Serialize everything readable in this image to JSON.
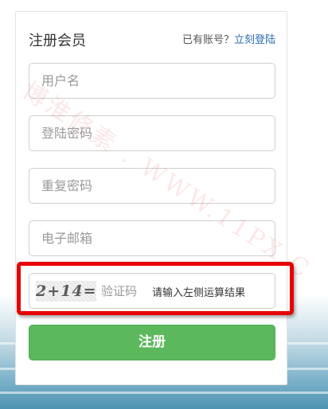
{
  "form": {
    "title": "注册会员",
    "login_prompt": "已有账号？",
    "login_link": "立刻登陆",
    "username_placeholder": "用户名",
    "password_placeholder": "登陆密码",
    "confirm_password_placeholder": "重复密码",
    "email_placeholder": "电子邮箱",
    "captcha_image_text": "2+14=",
    "captcha_placeholder": "验证码",
    "captcha_hint": "请输入左侧运算结果",
    "submit_label": "注册"
  },
  "watermark": {
    "text": "博淮修素 . WWW.11PX.C"
  },
  "colors": {
    "accent_green": "#5cb85c",
    "link_blue": "#2b6cb0",
    "highlight_red": "#e80000"
  }
}
